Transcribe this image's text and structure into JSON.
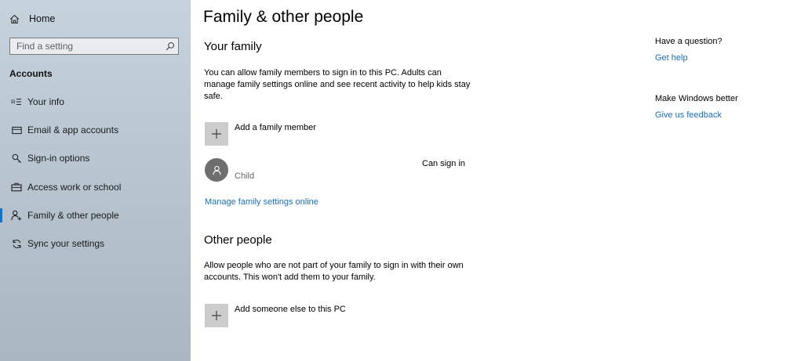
{
  "sidebar": {
    "home_label": "Home",
    "search_placeholder": "Find a setting",
    "section_title": "Accounts",
    "items": [
      {
        "label": "Your info",
        "icon": "contact-card-icon",
        "active": false
      },
      {
        "label": "Email & app accounts",
        "icon": "mail-icon",
        "active": false
      },
      {
        "label": "Sign-in options",
        "icon": "key-icon",
        "active": false
      },
      {
        "label": "Access work or school",
        "icon": "briefcase-icon",
        "active": false
      },
      {
        "label": "Family & other people",
        "icon": "add-person-icon",
        "active": true
      },
      {
        "label": "Sync your settings",
        "icon": "sync-icon",
        "active": false
      }
    ]
  },
  "main": {
    "title": "Family & other people",
    "family": {
      "heading": "Your family",
      "description": "You can allow family members to sign in to this PC. Adults can manage family settings online and see recent activity to help kids stay safe.",
      "add_label": "Add a family member",
      "member": {
        "role": "Child",
        "status": "Can sign in"
      },
      "manage_link": "Manage family settings online"
    },
    "other": {
      "heading": "Other people",
      "description": "Allow people who are not part of your family to sign in with their own accounts. This won't add them to your family.",
      "add_label": "Add someone else to this PC"
    }
  },
  "aside": {
    "question_heading": "Have a question?",
    "help_link": "Get help",
    "feedback_heading": "Make Windows better",
    "feedback_link": "Give us feedback"
  },
  "colors": {
    "accent": "#0078d7",
    "link": "#1a6fb5",
    "sidebar": "#bcc8d2"
  }
}
